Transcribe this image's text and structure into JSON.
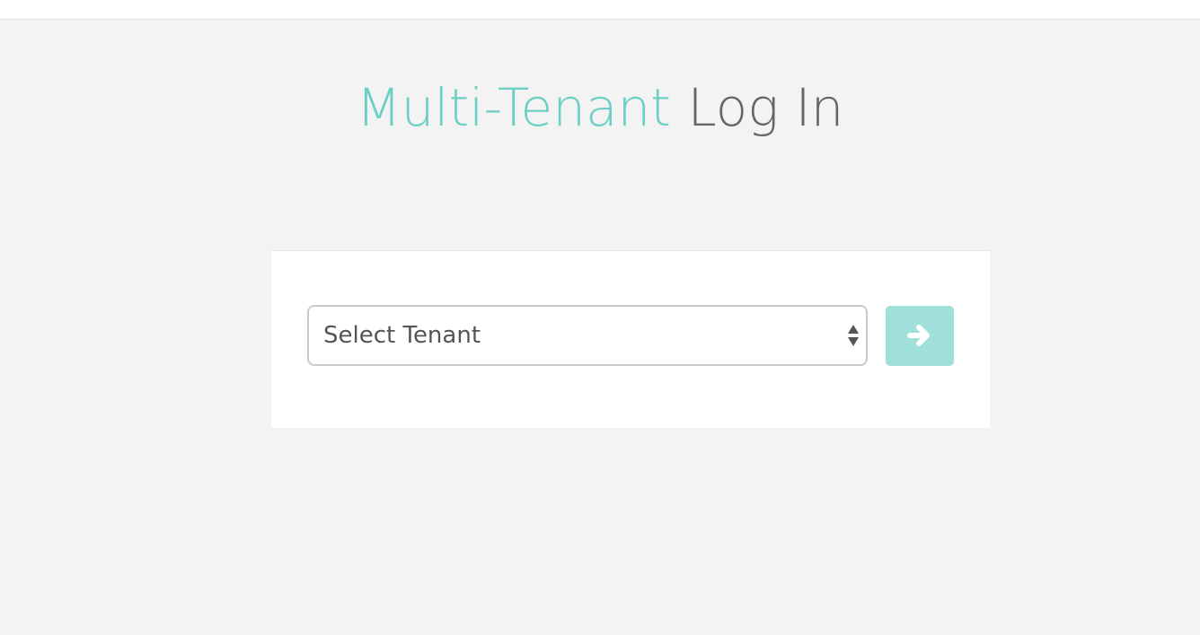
{
  "header": {
    "title_accent": "Multi-Tenant",
    "title_rest": "Log In"
  },
  "tenant_select": {
    "selected_label": "Select Tenant",
    "icon": "select-arrows-icon"
  },
  "submit": {
    "icon": "arrow-right-icon"
  },
  "colors": {
    "accent": "#6ccfc6",
    "button": "#9fe0da",
    "title_text": "#666666",
    "background": "#f3f3f3"
  }
}
